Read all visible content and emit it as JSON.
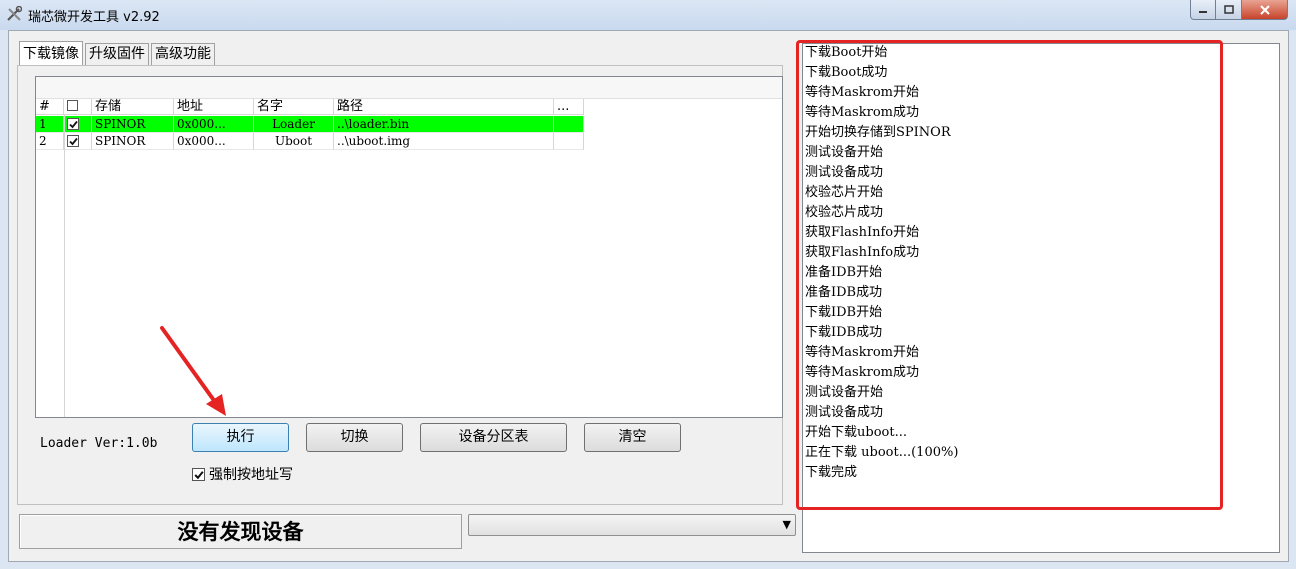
{
  "window": {
    "title": "瑞芯微开发工具 v2.92",
    "icon": "tools-icon",
    "minimize_label": "—",
    "maximize_label": "□",
    "close_label": "✕"
  },
  "tabs": [
    {
      "label": "下载镜像",
      "active": true
    },
    {
      "label": "升级固件",
      "active": false
    },
    {
      "label": "高级功能",
      "active": false
    }
  ],
  "table": {
    "columns": [
      "#",
      "",
      "存储",
      "地址",
      "名字",
      "路径",
      "..."
    ],
    "rows": [
      {
        "num": "1",
        "checked": true,
        "storage": "SPINOR",
        "address": "0x000...",
        "name": "Loader",
        "path": "..\\loader.bin",
        "selected": true
      },
      {
        "num": "2",
        "checked": true,
        "storage": "SPINOR",
        "address": "0x000...",
        "name": "Uboot",
        "path": "..\\uboot.img",
        "selected": false
      }
    ]
  },
  "loader_version": "Loader Ver:1.0b",
  "buttons": {
    "run": "执行",
    "switch": "切换",
    "partition_table": "设备分区表",
    "clear": "清空"
  },
  "force_address_write": {
    "label": "强制按地址写",
    "checked": true
  },
  "status": "没有发现设备",
  "device_combo": {
    "value": ""
  },
  "colors": {
    "selected_row": "#00ff00",
    "highlight_border": "#e52323",
    "annotation_arrow": "#e52323"
  },
  "log": [
    "下载Boot开始",
    "下载Boot成功",
    "等待Maskrom开始",
    "等待Maskrom成功",
    "开始切换存储到SPINOR",
    "测试设备开始",
    "测试设备成功",
    "校验芯片开始",
    "校验芯片成功",
    "获取FlashInfo开始",
    "获取FlashInfo成功",
    "准备IDB开始",
    "准备IDB成功",
    "下载IDB开始",
    "下载IDB成功",
    "等待Maskrom开始",
    "等待Maskrom成功",
    "测试设备开始",
    "测试设备成功",
    "开始下载uboot...",
    "正在下载 uboot...(100%)",
    "下载完成"
  ]
}
